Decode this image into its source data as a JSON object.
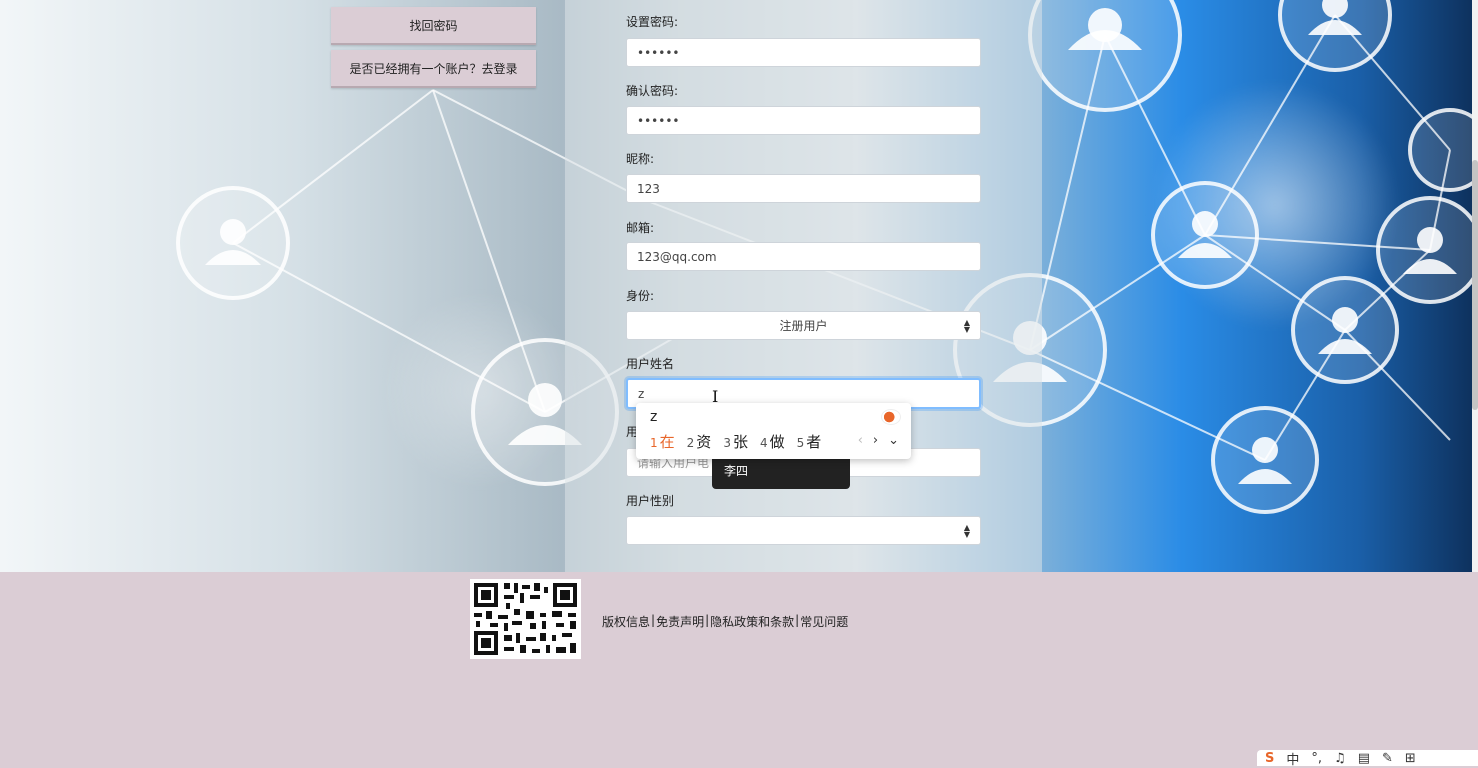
{
  "links": {
    "find_password": "找回密码",
    "have_account": "是否已经拥有一个账户？去登录"
  },
  "form": {
    "set_password_label": "设置密码:",
    "set_password_value": "••••••",
    "confirm_password_label": "确认密码:",
    "confirm_password_value": "••••••",
    "nickname_label": "昵称:",
    "nickname_value": "123",
    "email_label": "邮箱:",
    "email_value": "123@qq.com",
    "identity_label": "身份:",
    "identity_value": "注册用户",
    "user_name_label": "用户姓名",
    "user_name_value": "z",
    "user_phone_label": "用",
    "user_phone_placeholder": "请输入用户电",
    "user_gender_label": "用户性别",
    "user_gender_value": ""
  },
  "ime": {
    "composition": "z",
    "candidates": [
      {
        "num": "1",
        "text": "在"
      },
      {
        "num": "2",
        "text": "资"
      },
      {
        "num": "3",
        "text": "张"
      },
      {
        "num": "4",
        "text": "做"
      },
      {
        "num": "5",
        "text": "者"
      }
    ],
    "prev": "‹",
    "next": "›",
    "expand": "⌄"
  },
  "autocomplete_suggestion": "李四",
  "footer": {
    "copyright": "版权信息",
    "disclaimer": "免责声明",
    "privacy": "隐私政策和条款",
    "faq": "常见问题",
    "separator": "|"
  },
  "tray": {
    "sogou": "S",
    "chinese": "中",
    "punct": "°,",
    "mic": "♫",
    "keyboard": "▤",
    "skin": "✎",
    "toolbox": "⊞"
  }
}
